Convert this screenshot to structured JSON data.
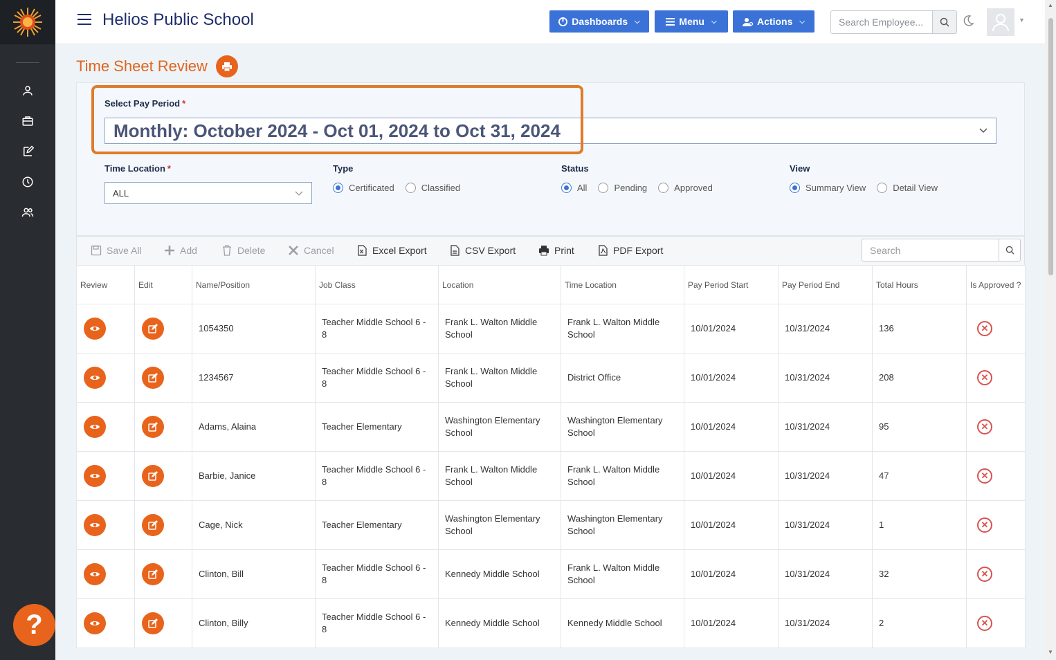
{
  "header": {
    "school_name": "Helios Public School",
    "dashboards_label": "Dashboards",
    "menu_label": "Menu",
    "actions_label": "Actions",
    "search_placeholder": "Search Employee..."
  },
  "page": {
    "title": "Time Sheet Review"
  },
  "filters": {
    "pay_period_label": "Select Pay Period",
    "pay_period_value": "Monthly: October 2024 - Oct 01, 2024 to Oct 31, 2024",
    "time_location_label": "Time Location",
    "time_location_value": "ALL",
    "type_label": "Type",
    "type_options": [
      "Certificated",
      "Classified"
    ],
    "type_selected": "Certificated",
    "status_label": "Status",
    "status_options": [
      "All",
      "Pending",
      "Approved"
    ],
    "status_selected": "All",
    "view_label": "View",
    "view_options": [
      "Summary View",
      "Detail View"
    ],
    "view_selected": "Summary View"
  },
  "toolbar": {
    "save_all": "Save All",
    "add": "Add",
    "delete": "Delete",
    "cancel": "Cancel",
    "excel_export": "Excel Export",
    "csv_export": "CSV Export",
    "print": "Print",
    "pdf_export": "PDF Export",
    "search_placeholder": "Search"
  },
  "table": {
    "columns": [
      "Review",
      "Edit",
      "Name/Position",
      "Job Class",
      "Location",
      "Time Location",
      "Pay Period Start",
      "Pay Period End",
      "Total Hours",
      "Is Approved ?"
    ],
    "rows": [
      {
        "name": "1054350",
        "job_class": "Teacher Middle School 6 - 8",
        "location": "Frank L. Walton Middle School",
        "time_location": "Frank L. Walton Middle School",
        "start": "10/01/2024",
        "end": "10/31/2024",
        "hours": "136"
      },
      {
        "name": "1234567",
        "job_class": "Teacher Middle School 6 - 8",
        "location": "Frank L. Walton Middle School",
        "time_location": "District Office",
        "start": "10/01/2024",
        "end": "10/31/2024",
        "hours": "208"
      },
      {
        "name": "Adams, Alaina",
        "job_class": "Teacher Elementary",
        "location": "Washington Elementary School",
        "time_location": "Washington Elementary School",
        "start": "10/01/2024",
        "end": "10/31/2024",
        "hours": "95"
      },
      {
        "name": "Barbie, Janice",
        "job_class": "Teacher Middle School 6 - 8",
        "location": "Frank L. Walton Middle School",
        "time_location": "Frank L. Walton Middle School",
        "start": "10/01/2024",
        "end": "10/31/2024",
        "hours": "47"
      },
      {
        "name": "Cage, Nick",
        "job_class": "Teacher Elementary",
        "location": "Washington Elementary School",
        "time_location": "Washington Elementary School",
        "start": "10/01/2024",
        "end": "10/31/2024",
        "hours": "1"
      },
      {
        "name": "Clinton, Bill",
        "job_class": "Teacher Middle School 6 - 8",
        "location": "Kennedy Middle School",
        "time_location": "Frank L. Walton Middle School",
        "start": "10/01/2024",
        "end": "10/31/2024",
        "hours": "32"
      },
      {
        "name": "Clinton, Billy",
        "job_class": "Teacher Middle School 6 - 8",
        "location": "Kennedy Middle School",
        "time_location": "Kennedy Middle School",
        "start": "10/01/2024",
        "end": "10/31/2024",
        "hours": "2"
      }
    ]
  },
  "colors": {
    "accent_orange": "#e8641c",
    "primary_blue": "#3b72d8",
    "sidebar_dark": "#292c30",
    "reject_red": "#d9534f"
  },
  "icons": {
    "sidebar": [
      "user-icon",
      "briefcase-icon",
      "edit-icon",
      "clock-icon",
      "users-icon"
    ]
  },
  "help": {
    "label": "?"
  }
}
